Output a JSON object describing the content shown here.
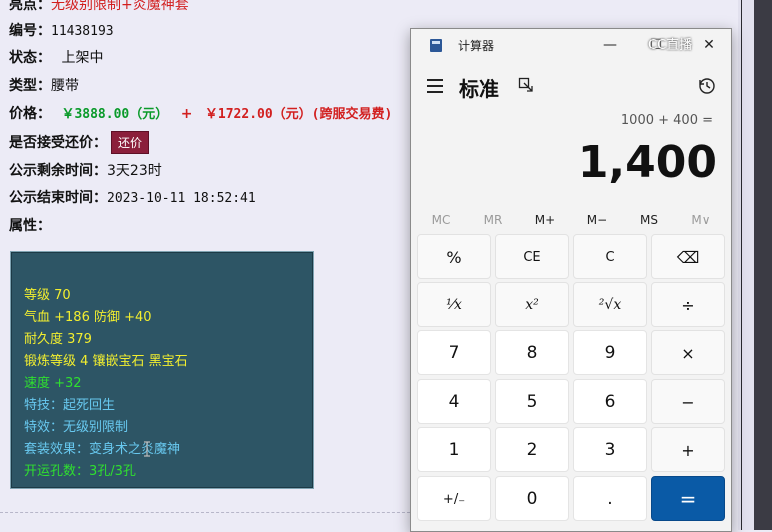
{
  "listing": {
    "top_partial": {
      "label": "亮点：",
      "value": "无级别限制+炎魔神套"
    },
    "number": {
      "label": "编号：",
      "value": "11438193"
    },
    "status": {
      "label": "状态：",
      "value": "上架中"
    },
    "type": {
      "label": "类型：",
      "value": "腰带"
    },
    "price": {
      "label": "价格：",
      "value": "￥3888.00（元）",
      "plus": "+",
      "extra": "￥1722.00（元）(跨服交易费)"
    },
    "accept_counter": {
      "label": "是否接受还价：",
      "button": "还价"
    },
    "remaining": {
      "label": "公示剩余时间：",
      "value": "3天23时"
    },
    "end_time": {
      "label": "公示结束时间：",
      "value": "2023-10-11 18:52:41"
    },
    "attributes_label": "属性：",
    "attributes": [
      {
        "text": "等级 70",
        "color": "yellow"
      },
      {
        "text": "气血 +186 防御 +40",
        "color": "yellow"
      },
      {
        "text": "耐久度 379",
        "color": "yellow"
      },
      {
        "text": "锻炼等级 4 镶嵌宝石 黑宝石",
        "color": "yellow"
      },
      {
        "text": "速度 +32",
        "color": "green"
      },
      {
        "text": "特技：起死回生",
        "color": "cyan"
      },
      {
        "text": "特效：无级别限制",
        "color": "cyan"
      },
      {
        "text": "套装效果：变身术之炎魔神",
        "color": "cyan"
      },
      {
        "text": "开运孔数：3孔/3孔",
        "color": "green"
      }
    ]
  },
  "calculator": {
    "title": "计算器",
    "watermark": "CC直播",
    "mode": "标准",
    "expression": "1000 + 400 =",
    "result": "1,400",
    "memory": [
      "MC",
      "MR",
      "M+",
      "M−",
      "MS",
      "M∨"
    ],
    "keys": [
      [
        "%",
        "CE",
        "C",
        "⌫"
      ],
      [
        "¹⁄x",
        "x²",
        "²√x",
        "÷"
      ],
      [
        "7",
        "8",
        "9",
        "×"
      ],
      [
        "4",
        "5",
        "6",
        "−"
      ],
      [
        "1",
        "2",
        "3",
        "+"
      ],
      [
        "+/₋",
        "0",
        ".",
        "="
      ]
    ],
    "accent": "#0a5aa6"
  }
}
